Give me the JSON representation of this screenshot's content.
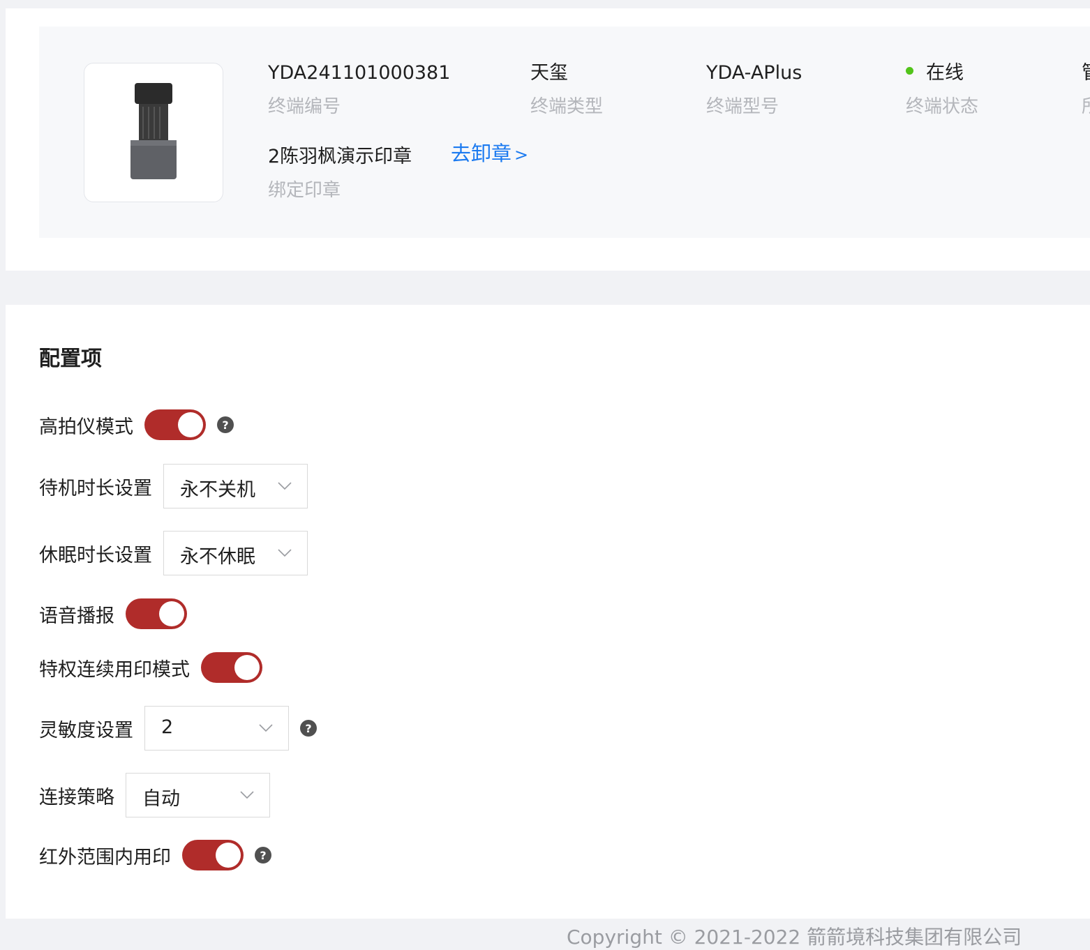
{
  "device": {
    "image_alt": "YDA-APlus device",
    "fields": [
      {
        "value": "YDA241101000381",
        "label": "终端编号"
      },
      {
        "value": "天玺",
        "label": "终端类型"
      },
      {
        "value": "YDA-APlus",
        "label": "终端型号"
      },
      {
        "value": "在线",
        "label": "终端状态",
        "status_color": "#52c41a"
      }
    ],
    "partial_value": "管",
    "partial_label": "所",
    "seal": {
      "value": "2陈羽枫演示印章",
      "label": "绑定印章"
    },
    "unmount_link": "去卸章",
    "unmount_chevron": ">"
  },
  "config": {
    "title": "配置项",
    "help_glyph": "?",
    "items": [
      {
        "label": "高拍仪模式",
        "type": "toggle",
        "on": true,
        "help": true
      },
      {
        "label": "待机时长设置",
        "type": "select",
        "value": "永不关机"
      },
      {
        "label": "休眠时长设置",
        "type": "select",
        "value": "永不休眠"
      },
      {
        "label": "语音播报",
        "type": "toggle",
        "on": true
      },
      {
        "label": "特权连续用印模式",
        "type": "toggle",
        "on": true
      },
      {
        "label": "灵敏度设置",
        "type": "select",
        "value": "2",
        "help": true
      },
      {
        "label": "连接策略",
        "type": "select",
        "value": "自动"
      },
      {
        "label": "红外范围内用印",
        "type": "toggle",
        "on": true,
        "help": true
      }
    ]
  },
  "footer": {
    "text": "Copyright © 2021-2022 箭箭境科技集团有限公司"
  },
  "colors": {
    "accent": "#b02c2a",
    "link": "#1b7af0",
    "online": "#52c41a"
  }
}
